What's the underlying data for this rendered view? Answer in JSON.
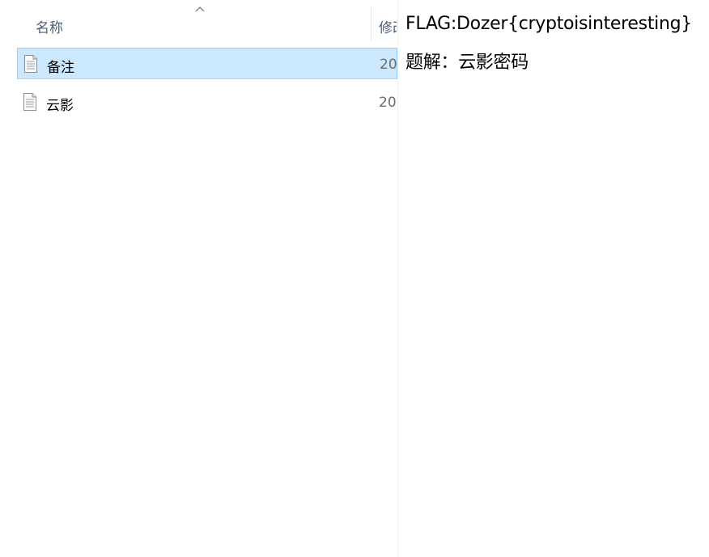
{
  "columns": {
    "name": "名称",
    "modified": "修改日期"
  },
  "files": [
    {
      "name": "备注",
      "date": "20",
      "selected": true,
      "icon": "text-file-icon"
    },
    {
      "name": "云影",
      "date": "20",
      "selected": false,
      "icon": "text-file-icon"
    }
  ],
  "preview": {
    "line1": "FLAG:Dozer{cryptoisinteresting}",
    "line2": "题解：云影密码"
  },
  "colors": {
    "selection_bg": "#cce8ff",
    "selection_border": "#99d1ff",
    "header_text": "#4c607a"
  }
}
